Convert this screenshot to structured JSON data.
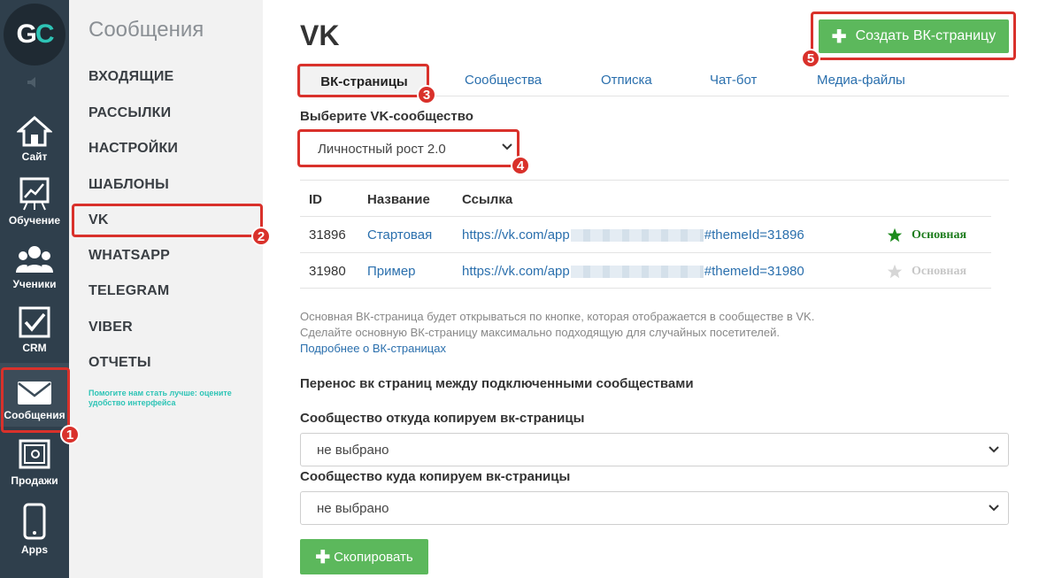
{
  "rail": {
    "logo_g": "G",
    "logo_c": "C",
    "items": [
      {
        "label": "Сайт",
        "icon": "house-icon"
      },
      {
        "label": "Обучение",
        "icon": "chart-board-icon"
      },
      {
        "label": "Ученики",
        "icon": "users-icon"
      },
      {
        "label": "CRM",
        "icon": "checkbox-icon"
      },
      {
        "label": "Сообщения",
        "icon": "envelope-icon"
      },
      {
        "label": "Продажи",
        "icon": "safe-icon"
      },
      {
        "label": "Apps",
        "icon": "phone-icon"
      }
    ]
  },
  "sidebar": {
    "title": "Сообщения",
    "items": [
      "ВХОДЯЩИЕ",
      "РАССЫЛКИ",
      "НАСТРОЙКИ",
      "ШАБЛОНЫ",
      "VK",
      "WHATSAPP",
      "TELEGRAM",
      "VIBER",
      "ОТЧЕТЫ"
    ],
    "hint": "Помогите нам стать лучше: оцените удобство интерфейса"
  },
  "badges": [
    "1",
    "2",
    "3",
    "4",
    "5"
  ],
  "main": {
    "title": "VK",
    "create_button": "Создать ВК-страницу",
    "tabs": [
      "ВК-страницы",
      "Сообщества",
      "Отписка",
      "Чат-бот",
      "Медиа-файлы"
    ],
    "community_label": "Выберите VK-сообщество",
    "community_value": "Личностный рост 2.0",
    "table": {
      "headers": [
        "ID",
        "Название",
        "Ссылка"
      ],
      "rows": [
        {
          "id": "31896",
          "name": "Стартовая",
          "link_start": "https://vk.com/app",
          "link_end": "#themeId=31896",
          "status": "Основная",
          "primary": true
        },
        {
          "id": "31980",
          "name": "Пример",
          "link_start": "https://vk.com/app",
          "link_end": "#themeId=31980",
          "status": "Основная",
          "primary": false
        }
      ]
    },
    "note_line1": "Основная ВК-страница будет открываться по кнопке, которая отображается в сообществе в VK.",
    "note_line2": "Сделайте основную ВК-страницу максимально подходящую для случайных посетителей.",
    "note_link": "Подробнее о ВК-страницах",
    "transfer_title": "Перенос вк страниц между подключенными сообществами",
    "from_label": "Сообщество откуда копируем вк-страницы",
    "from_value": "не выбрано",
    "to_label": "Сообщество куда копируем вк-страницы",
    "to_value": "не выбрано",
    "copy_button": "Скопировать"
  },
  "colors": {
    "rail": "#2f3f4c",
    "accent_green": "#5cb85c",
    "highlight_red": "#d9312b",
    "link": "#2a6fad",
    "hint": "#2ec4b6"
  }
}
